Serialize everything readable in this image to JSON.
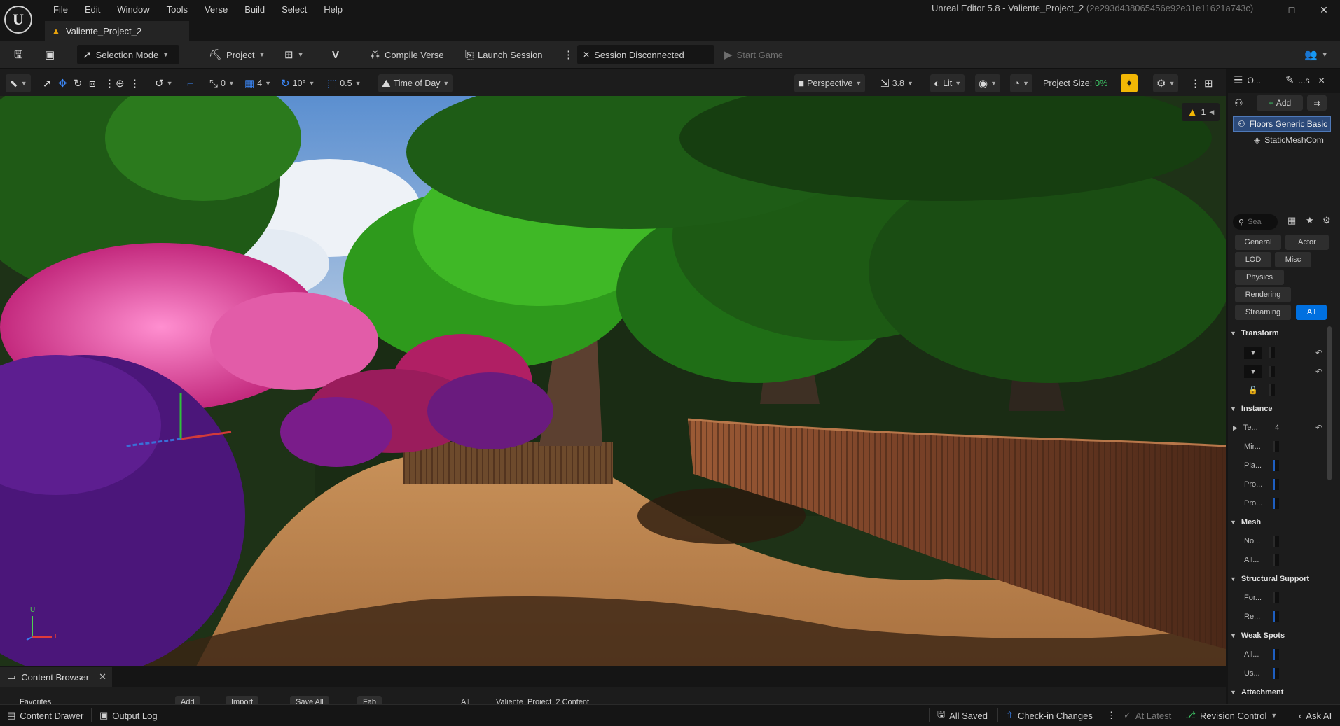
{
  "app": {
    "logo_letter": "U",
    "menus": [
      "File",
      "Edit",
      "Window",
      "Tools",
      "Verse",
      "Build",
      "Select",
      "Help"
    ],
    "window_title": "Unreal Editor 5.8 - Valiente_Project_2",
    "window_hash": "(2e293d438065456e92e31e11621a743c)",
    "window_controls": [
      "–",
      "□",
      "✕"
    ],
    "doc_tab": "Valiente_Project_2"
  },
  "toolbar": {
    "selection_mode": "Selection Mode",
    "project": "Project",
    "compile_verse": "Compile Verse",
    "launch_session": "Launch Session",
    "session_status": "Session Disconnected",
    "start_game": "Start Game"
  },
  "viewport_toolbar": {
    "rotate_snap_value": "0",
    "grid_value": "4",
    "angle_value": "10°",
    "scale_value": "0.5",
    "time_of_day": "Time of Day",
    "perspective": "Perspective",
    "camera_speed": "3.8",
    "lit": "Lit",
    "project_size_label": "Project Size:",
    "project_size_value": "0%"
  },
  "viewport": {
    "warning_count": "1",
    "axis_up": "U",
    "axis_left": "L"
  },
  "right_panel": {
    "tab_outliner": "O...",
    "tab_details": "...s",
    "add_button": "Add",
    "actor_name": "Floors Generic Basic",
    "component_name": "StaticMeshCom",
    "search_placeholder": "Sea",
    "filters": [
      "General",
      "Actor",
      "LOD",
      "Misc",
      "Physics",
      "Rendering",
      "Streaming",
      "All"
    ],
    "sections": {
      "transform": "Transform",
      "instance": "Instance",
      "mesh": "Mesh",
      "structural": "Structural Support",
      "weak": "Weak Spots",
      "attachment": "Attachment"
    },
    "instance_rows": [
      "Te...",
      "Mir...",
      "Pla...",
      "Pro...",
      "Pro..."
    ],
    "instance_first_value": "4",
    "mesh_rows": [
      "No...",
      "All..."
    ],
    "structural_rows": [
      "For...",
      "Re..."
    ],
    "weak_rows": [
      "All...",
      "Us..."
    ]
  },
  "content_browser": {
    "tab": "Content Browser",
    "strip": [
      "Favorites",
      "Add",
      "Import",
      "Save All",
      "Fab",
      "All",
      "Valiente_Project_2 Content"
    ]
  },
  "statusbar": {
    "content_drawer": "Content Drawer",
    "output_log": "Output Log",
    "all_saved": "All Saved",
    "check_in": "Check-in Changes",
    "at_latest": "At Latest",
    "revision_control": "Revision Control",
    "ask_ai": "Ask AI"
  }
}
